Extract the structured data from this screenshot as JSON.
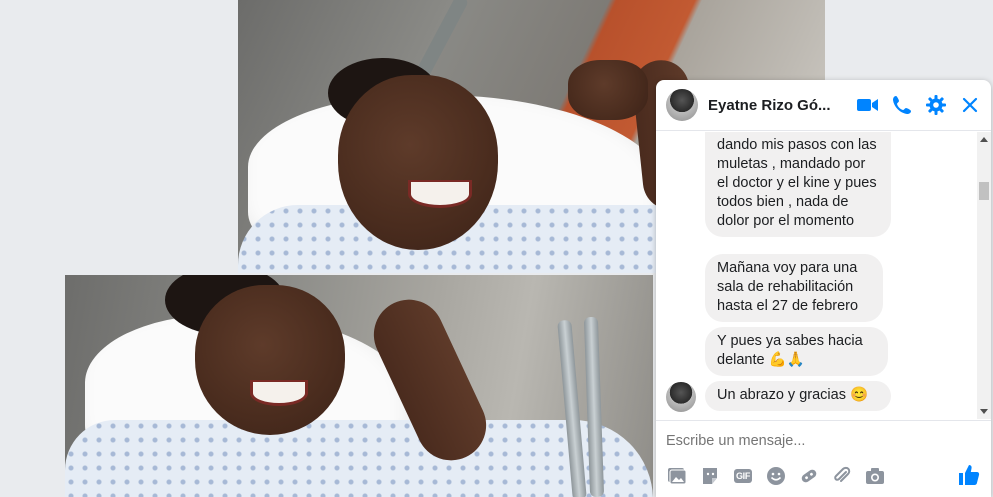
{
  "chat": {
    "contact_name": "Eyatne Rizo Gó...",
    "header_icons": [
      "video-call-icon",
      "phone-icon",
      "gear-icon",
      "close-icon"
    ],
    "accent_color": "#0084ff",
    "messages": [
      {
        "text": "dando mis pasos con las muletas , mandado por el doctor y el kine y pues todos bien , nada de dolor por el momento"
      },
      {
        "text": "Mañana voy para una sala de rehabilitación hasta el 27 de febrero"
      },
      {
        "text": "Y pues ya sabes hacia delante 💪🙏"
      },
      {
        "text": "Un abrazo y gracias 😊"
      }
    ],
    "composer": {
      "placeholder": "Escribe un mensaje...",
      "tools": [
        "photo-icon",
        "sticker-icon",
        "gif-icon",
        "emoji-icon",
        "games-icon",
        "attachment-icon",
        "camera-icon"
      ],
      "gif_label": "GIF"
    }
  }
}
